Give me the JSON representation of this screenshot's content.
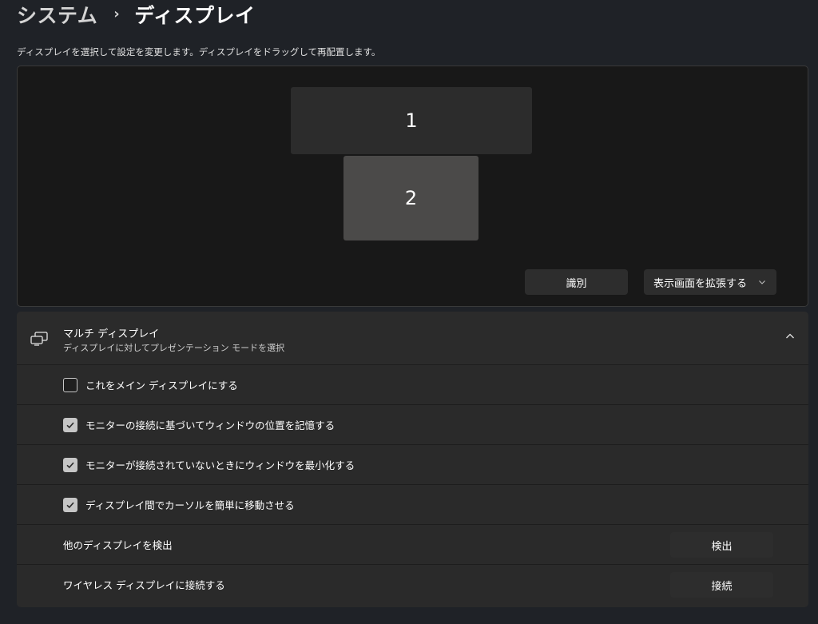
{
  "breadcrumb": {
    "parent": "システム",
    "separator": "›",
    "current": "ディスプレイ"
  },
  "instruction": "ディスプレイを選択して設定を変更します。ディスプレイをドラッグして再配置します。",
  "display_arrangement": {
    "monitors": [
      {
        "label": "1"
      },
      {
        "label": "2"
      }
    ],
    "identify_label": "識別",
    "mode_dropdown": {
      "selected": "表示画面を拡張する",
      "icon": "chevron-down-icon"
    }
  },
  "multi_display": {
    "icon": "multi-display-icon",
    "title": "マルチ ディスプレイ",
    "subtitle": "ディスプレイに対してプレゼンテーション モードを選択",
    "expanded": true,
    "options": [
      {
        "label": "これをメイン ディスプレイにする",
        "checked": false
      },
      {
        "label": "モニターの接続に基づいてウィンドウの位置を記憶する",
        "checked": true
      },
      {
        "label": "モニターが接続されていないときにウィンドウを最小化する",
        "checked": true
      },
      {
        "label": "ディスプレイ間でカーソルを簡単に移動させる",
        "checked": true
      }
    ],
    "detect": {
      "label": "他のディスプレイを検出",
      "button": "検出"
    },
    "wireless": {
      "label": "ワイヤレス ディスプレイに接続する",
      "button": "接続"
    }
  },
  "colors": {
    "background": "#1f2227",
    "panel": "#2a2a2a",
    "button": "#2d2d2d",
    "monitor_1": "#2c2c2c",
    "monitor_2_selected": "#4b4a49"
  }
}
